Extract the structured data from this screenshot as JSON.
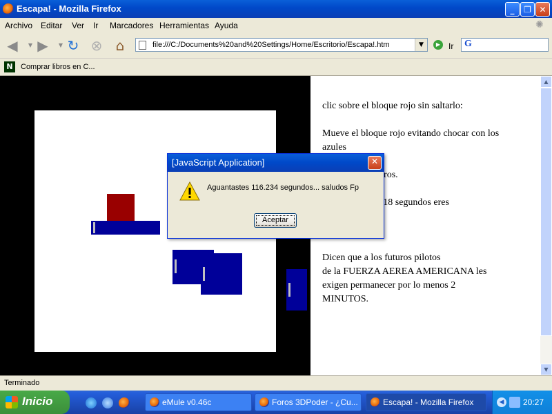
{
  "window": {
    "title": "Escapa! - Mozilla Firefox",
    "minimize": "_",
    "maximize": "❐",
    "close": "✕"
  },
  "menu": [
    "Archivo",
    "Editar",
    "Ver",
    "Ir",
    "Marcadores",
    "Herramientas",
    "Ayuda"
  ],
  "nav": {
    "url": "file:///C:/Documents%20and%20Settings/Home/Escritorio/Escapa!.htm",
    "dropdown": "▼",
    "go_label": "Ir",
    "search_logo": "G"
  },
  "bookmarks": {
    "icon_letter": "N",
    "label": "Comprar libros en C..."
  },
  "page": {
    "lines": [
      "clic sobre el bloque rojo sin saltarlo:",
      "Mueve el bloque rojo evitando chocar con los",
      "azules",
      "r los bordes negros.",
      "guantar más de 18 segundos eres",
      "Dicen que a los futuros pilotos",
      "de la FUERZA AEREA AMERICANA les",
      "exigen permanecer por lo menos 2",
      "MINUTOS."
    ]
  },
  "dialog": {
    "title": "[JavaScript Application]",
    "message": "Aguantastes  116.234 segundos... saludos Fp",
    "ok_label": "Aceptar",
    "close": "✕"
  },
  "status": {
    "text": "Terminado"
  },
  "taskbar": {
    "start_label": "Inicio",
    "tasks": [
      {
        "label": "eMule v0.46c",
        "active": false
      },
      {
        "label": "Foros 3DPoder - ¿Cu...",
        "active": false
      },
      {
        "label": "Escapa! - Mozilla Firefox",
        "active": true
      }
    ],
    "clock": "20:27"
  },
  "colors": {
    "red_block": "#990000",
    "blue_block": "#000099",
    "border": "#000000"
  }
}
